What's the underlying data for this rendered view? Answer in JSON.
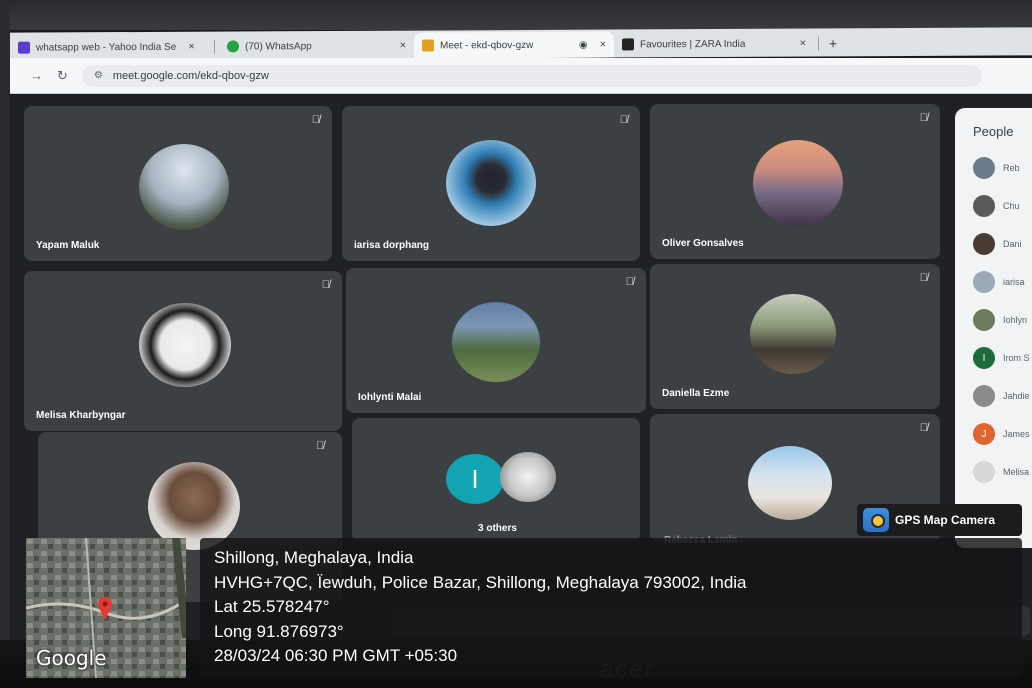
{
  "browser": {
    "tabs": [
      {
        "title": "whatsapp web - Yahoo India Se",
        "favicon_color": "#5b3bd4",
        "active": false
      },
      {
        "title": "(70) WhatsApp",
        "favicon_color": "#25a244",
        "active": false
      },
      {
        "title": "Meet - ekd-qbov-gzw",
        "favicon_color": "#e0a123",
        "active": true
      },
      {
        "title": "Favourites | ZARA India",
        "favicon_color": "#222222",
        "active": false
      }
    ],
    "close_glyph": "×",
    "new_tab_glyph": "+",
    "url": "meet.google.com/ekd-qbov-gzw"
  },
  "meet": {
    "participants": [
      {
        "name": "Yapam Maluk",
        "muted": true
      },
      {
        "name": "iarisa dorphang",
        "muted": true
      },
      {
        "name": "Oliver Gonsalves",
        "muted": true
      },
      {
        "name": "Melisa Kharbyngar",
        "muted": true
      },
      {
        "name": "Iohlynti Malai",
        "muted": true
      },
      {
        "name": "Daniella Ezme",
        "muted": true
      },
      {
        "name": "",
        "muted": true
      },
      {
        "name": "3 others",
        "muted": false,
        "avatar_initial": "I"
      },
      {
        "name": "Rebecca Lamin",
        "muted": true
      }
    ],
    "people_panel": {
      "title": "People",
      "entries": [
        {
          "label": "Reb",
          "initial": "",
          "color": "#6b7b8c"
        },
        {
          "label": "Chu",
          "initial": "",
          "color": "#5a5a5a"
        },
        {
          "label": "Dani",
          "initial": "",
          "color": "#4a3b34"
        },
        {
          "label": "iarisa",
          "initial": "",
          "color": "#9aa8b8"
        },
        {
          "label": "Iohlyn",
          "initial": "",
          "color": "#6c7a5c"
        },
        {
          "label": "Irom S",
          "initial": "I",
          "color": "#1e6b3a"
        },
        {
          "label": "Jahdie",
          "initial": "",
          "color": "#8a8a8a"
        },
        {
          "label": "James",
          "initial": "J",
          "color": "#e0642d"
        },
        {
          "label": "Melisa",
          "initial": "",
          "color": "#d8d8d8"
        }
      ]
    }
  },
  "gps_overlay": {
    "badge": "GPS Map Camera",
    "map_label": "Google",
    "lines": [
      "Shillong, Meghalaya, India",
      "HVHG+7QC, Ïewduh, Police Bazar, Shillong, Meghalaya 793002, India",
      "Lat 25.578247°",
      "Long 91.876973°",
      "28/03/24 06:30 PM GMT +05:30"
    ]
  },
  "monitor_brand": "acer"
}
